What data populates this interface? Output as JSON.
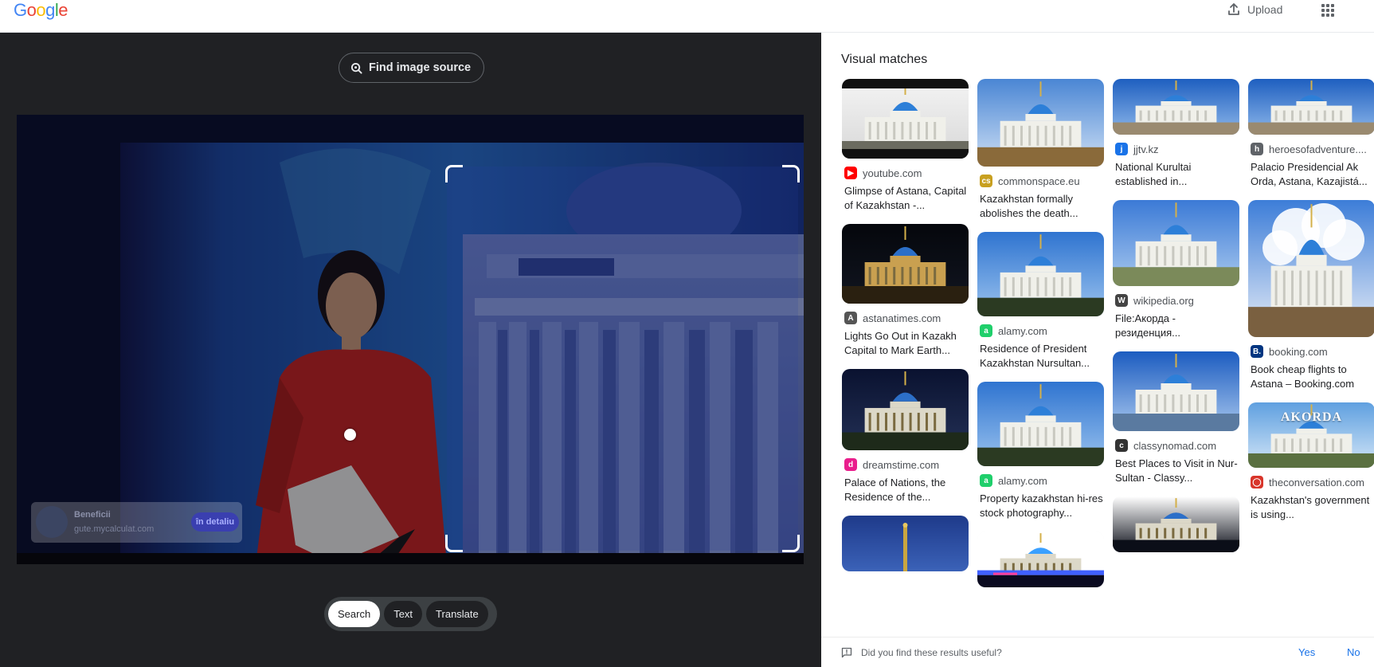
{
  "header": {
    "logo_letters": [
      "G",
      "o",
      "o",
      "g",
      "l",
      "e"
    ],
    "logo_colors": [
      "#4285F4",
      "#EA4335",
      "#FBBC05",
      "#4285F4",
      "#34A853",
      "#EA4335"
    ],
    "upload_label": "Upload",
    "upload_icon": "upload-icon",
    "apps_icon": "apps-grid-icon"
  },
  "viewer": {
    "find_source_label": "Find image source",
    "find_source_icon": "lens-icon",
    "ad": {
      "title": "Beneficii",
      "url": "gute.mycalculat.com",
      "cta": "în detaliu"
    },
    "modes": [
      {
        "label": "Search",
        "active": true
      },
      {
        "label": "Text",
        "active": false
      },
      {
        "label": "Translate",
        "active": false
      }
    ]
  },
  "results": {
    "title": "Visual matches",
    "columns": [
      [
        {
          "source": "youtube.com",
          "favicon": "youtube-icon",
          "fav_color": "#ff0000",
          "fav_char": "▶",
          "caption": "Glimpse of Astana, Capital of Kazakhstan -...",
          "scene": "dark-palace"
        },
        {
          "source": "astanatimes.com",
          "favicon": "astanatimes-icon",
          "fav_color": "#555555",
          "fav_char": "A",
          "caption": "Lights Go Out in Kazakh Capital to Mark Earth...",
          "scene": "night-palace"
        },
        {
          "source": "dreamstime.com",
          "favicon": "dreamstime-icon",
          "fav_color": "#e91e8c",
          "fav_char": "d",
          "caption": "Palace of Nations, the Residence of the...",
          "scene": "night-lit"
        },
        {
          "source": "",
          "favicon": "",
          "fav_color": "",
          "fav_char": "",
          "caption": "",
          "scene": "spire-blue"
        }
      ],
      [
        {
          "source": "commonspace.eu",
          "favicon": "commonspace-icon",
          "fav_color": "#c8a020",
          "fav_char": "cs",
          "caption": "Kazakhstan formally abolishes the death...",
          "scene": "day-palace"
        },
        {
          "source": "alamy.com",
          "favicon": "alamy-icon",
          "fav_color": "#1fcf6b",
          "fav_char": "a",
          "caption": "Residence of President Kazakhstan Nursultan...",
          "scene": "stock-palace"
        },
        {
          "source": "alamy.com",
          "favicon": "alamy-icon",
          "fav_color": "#1fcf6b",
          "fav_char": "a",
          "caption": "Property kazakhstan hi-res stock photography...",
          "scene": "stock-palace"
        },
        {
          "source": "",
          "favicon": "",
          "fav_color": "",
          "fav_char": "",
          "caption": "",
          "scene": "night-colored"
        }
      ],
      [
        {
          "source": "jjtv.kz",
          "favicon": "jjtv-icon",
          "fav_color": "#1a73e8",
          "fav_char": "j",
          "caption": "National Kurultai established in...",
          "scene": "wide-palace"
        },
        {
          "source": "wikipedia.org",
          "favicon": "wikipedia-icon",
          "fav_color": "#444444",
          "fav_char": "W",
          "caption": "File:Акорда - резиденция...",
          "scene": "cloud-palace"
        },
        {
          "source": "classynomad.com",
          "favicon": "classynomad-icon",
          "fav_color": "#333333",
          "fav_char": "c",
          "caption": "Best Places to Visit in Nur-Sultan - Classy...",
          "scene": "fountain-palace"
        },
        {
          "source": "",
          "favicon": "",
          "fav_color": "",
          "fav_char": "",
          "caption": "",
          "scene": "night-moon"
        }
      ],
      [
        {
          "source": "heroesofadventure....",
          "favicon": "heroes-icon",
          "fav_color": "#5f6368",
          "fav_char": "h",
          "caption": "Palacio Presidencial Ak Orda, Astana, Kazajistá...",
          "scene": "wide-palace"
        },
        {
          "source": "booking.com",
          "favicon": "booking-icon",
          "fav_color": "#003580",
          "fav_char": "B.",
          "caption": "Book cheap flights to Astana – Booking.com",
          "scene": "tall-palace"
        },
        {
          "source": "theconversation.com",
          "favicon": "theconversation-icon",
          "fav_color": "#d8352a",
          "fav_char": "◯",
          "caption": "Kazakhstan's government is using...",
          "scene": "akorda",
          "overlay_text": "AKORDA"
        }
      ]
    ]
  },
  "feedback": {
    "question": "Did you find these results useful?",
    "yes": "Yes",
    "no": "No",
    "icon": "feedback-icon"
  }
}
